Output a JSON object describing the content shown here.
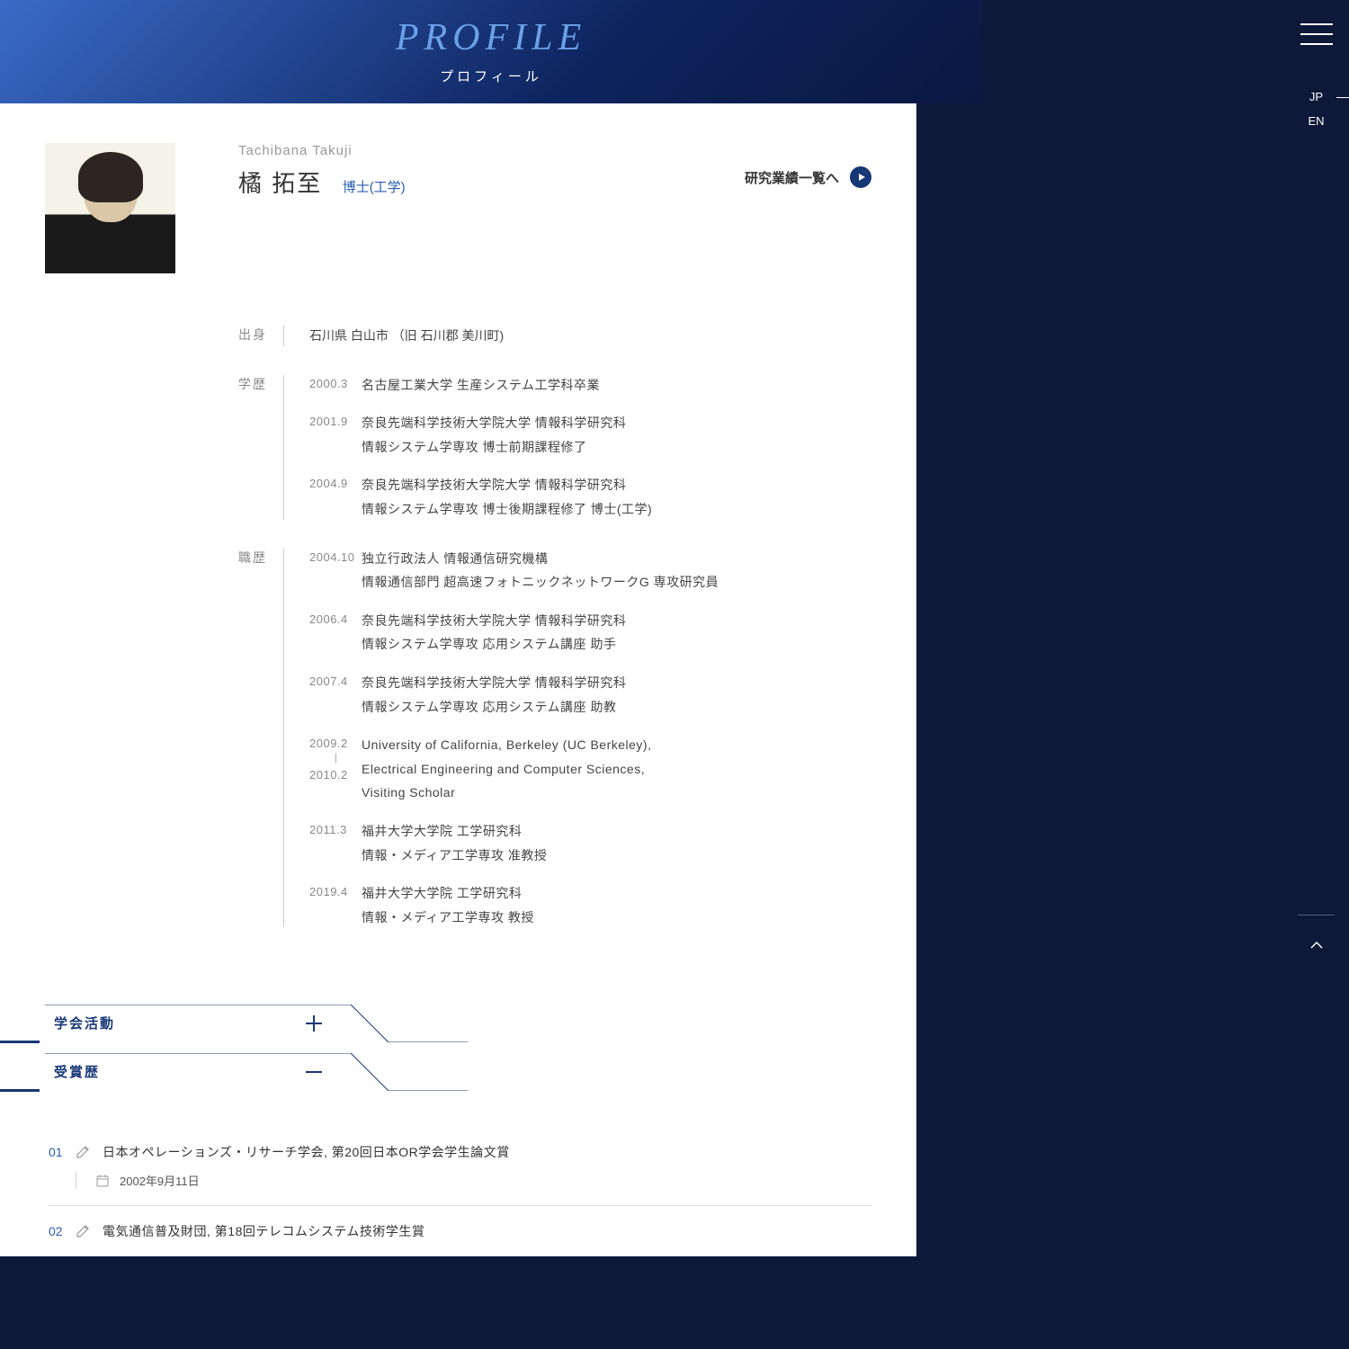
{
  "header": {
    "title_en": "PROFILE",
    "title_jp": "プロフィール"
  },
  "lang": {
    "jp": "JP",
    "en": "EN"
  },
  "research_link_label": "研究業績一覧へ",
  "profile": {
    "name_en": "Tachibana Takuji",
    "name_jp": "橘 拓至",
    "degree": "博士(工学)"
  },
  "origin": {
    "label": "出身",
    "value": "石川県 白山市 （旧 石川郡 美川町)"
  },
  "education": {
    "label": "学歴",
    "items": [
      {
        "date": "2000.3",
        "lines": [
          "名古屋工業大学 生産システム工学科卒業"
        ]
      },
      {
        "date": "2001.9",
        "lines": [
          "奈良先端科学技術大学院大学 情報科学研究科",
          "情報システム学専攻 博士前期課程修了"
        ]
      },
      {
        "date": "2004.9",
        "lines": [
          "奈良先端科学技術大学院大学 情報科学研究科",
          "情報システム学専攻 博士後期課程修了 博士(工学)"
        ]
      }
    ]
  },
  "career": {
    "label": "職歴",
    "items": [
      {
        "date": "2004.10",
        "lines": [
          "独立行政法人 情報通信研究機構",
          "情報通信部門 超高速フォトニックネットワークG 専攻研究員"
        ]
      },
      {
        "date": "2006.4",
        "lines": [
          "奈良先端科学技術大学院大学 情報科学研究科",
          "情報システム学専攻 応用システム講座 助手"
        ]
      },
      {
        "date": "2007.4",
        "lines": [
          "奈良先端科学技術大学院大学 情報科学研究科",
          "情報システム学専攻 応用システム講座 助教"
        ]
      },
      {
        "date_start": "2009.2",
        "date_end": "2010.2",
        "lines": [
          "University of California, Berkeley (UC Berkeley),",
          "Electrical Engineering and Computer Sciences,",
          "Visiting Scholar"
        ]
      },
      {
        "date": "2011.3",
        "lines": [
          "福井大学大学院 工学研究科",
          "情報・メディア工学専攻 准教授"
        ]
      },
      {
        "date": "2019.4",
        "lines": [
          "福井大学大学院 工学研究科",
          "情報・メディア工学専攻 教授"
        ]
      }
    ]
  },
  "accordions": {
    "activities_label": "学会活動",
    "awards_label": "受賞歴"
  },
  "awards": [
    {
      "num": "01",
      "title": "日本オペレーションズ・リサーチ学会, 第20回日本OR学会学生論文賞",
      "date": "2002年9月11日"
    },
    {
      "num": "02",
      "title": "電気通信普及財団, 第18回テレコムシステム技術学生賞"
    }
  ]
}
